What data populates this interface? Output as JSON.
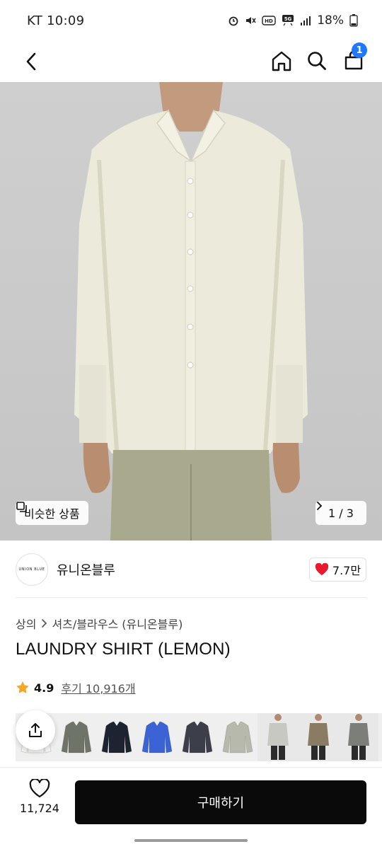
{
  "status_bar": {
    "left": "KT 10:09",
    "battery": "18%",
    "network": "5G"
  },
  "app_bar": {
    "cart_count": "1"
  },
  "hero": {
    "similar_label": "비슷한 상품",
    "pager": "1 / 3"
  },
  "brand": {
    "logo_text": "UNION BLUE",
    "name": "유니온블루",
    "likes": "7.7만"
  },
  "breadcrumb": {
    "category": "상의",
    "subcategory": "셔츠/블라우스 (유니온블루)"
  },
  "product": {
    "title": "LAUNDRY SHIRT (LEMON)",
    "rating": "4.9",
    "review_text": "후기 10,916개"
  },
  "thumbnails": {
    "colors": [
      "#f4f4f2",
      "#6f7468",
      "#1e2331",
      "#3b63d6",
      "#3c3e4a",
      "#b8b9ad"
    ],
    "photos": [
      "#c8c8c2",
      "#8a7b63",
      "#7c7e7a"
    ]
  },
  "bottom_bar": {
    "wish_count": "11,724",
    "buy_label": "구매하기"
  },
  "colors": {
    "accent_blue": "#1f78ff",
    "heart_red": "#e8192c",
    "star": "#f5a623",
    "buy_bg": "#0a0a0a"
  }
}
